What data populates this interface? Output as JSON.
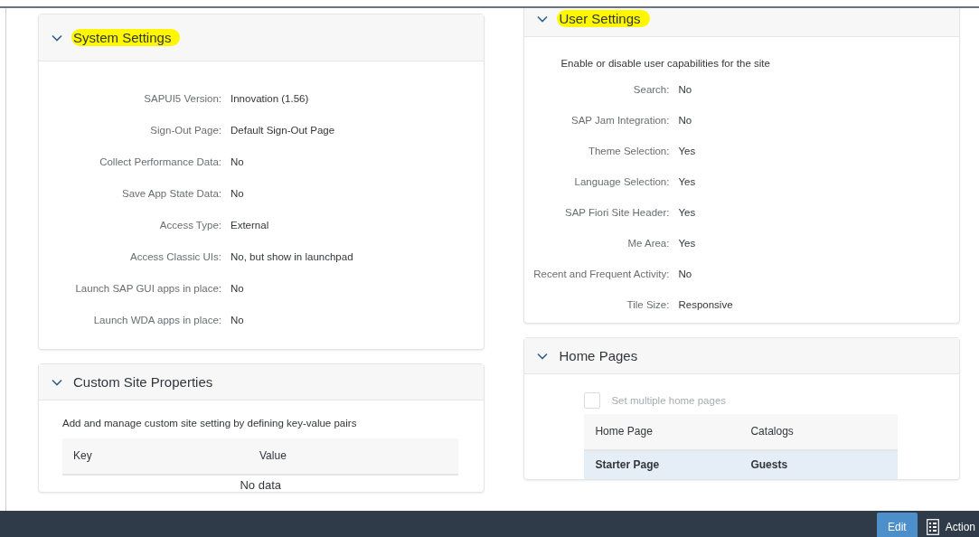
{
  "left_panels": [
    {
      "kind": "form",
      "title": "System Settings",
      "expanded": true,
      "highlighted": true,
      "fields": [
        {
          "label": "SAPUI5 Version:",
          "value": "Innovation (1.56)"
        },
        {
          "label": "Sign-Out Page:",
          "value": "Default Sign-Out Page"
        },
        {
          "label": "Collect Performance Data:",
          "value": "No"
        },
        {
          "label": "Save App State Data:",
          "value": "No"
        },
        {
          "label": "Access Type:",
          "value": "External"
        },
        {
          "label": "Access Classic UIs:",
          "value": "No, but show in launchpad"
        },
        {
          "label": "Launch SAP GUI apps in place:",
          "value": "No"
        },
        {
          "label": "Launch WDA apps in place:",
          "value": "No"
        }
      ]
    },
    {
      "kind": "table",
      "title": "Custom Site Properties",
      "expanded": true,
      "highlighted": false,
      "description": "Add and manage custom site setting by defining key-value pairs",
      "columns": [
        "Key",
        "Value"
      ],
      "empty_text": "No data"
    }
  ],
  "right_panels": [
    {
      "kind": "form",
      "title": "User Settings",
      "expanded": true,
      "highlighted": true,
      "description": "Enable or disable user capabilities for the site",
      "fields": [
        {
          "label": "Search:",
          "value": "No"
        },
        {
          "label": "SAP Jam Integration:",
          "value": "No"
        },
        {
          "label": "Theme Selection:",
          "value": "Yes"
        },
        {
          "label": "Language Selection:",
          "value": "Yes"
        },
        {
          "label": "SAP Fiori Site Header:",
          "value": "Yes"
        },
        {
          "label": "Me Area:",
          "value": "Yes"
        },
        {
          "label": "Recent and Frequent Activity:",
          "value": "No"
        },
        {
          "label": "Tile Size:",
          "value": "Responsive"
        }
      ]
    },
    {
      "kind": "table",
      "title": "Home Pages",
      "expanded": true,
      "highlighted": false,
      "checkbox": {
        "label": "Set multiple home pages",
        "checked": false,
        "disabled": true
      },
      "columns": [
        "Home Page",
        "Catalogs"
      ],
      "rows": [
        {
          "cells": [
            "Starter Page",
            "Guests"
          ],
          "selected": true
        }
      ]
    }
  ],
  "footer": {
    "buttons": [
      {
        "kind": "primary",
        "label": "Edit"
      },
      {
        "kind": "icon",
        "label": "Action"
      }
    ]
  }
}
